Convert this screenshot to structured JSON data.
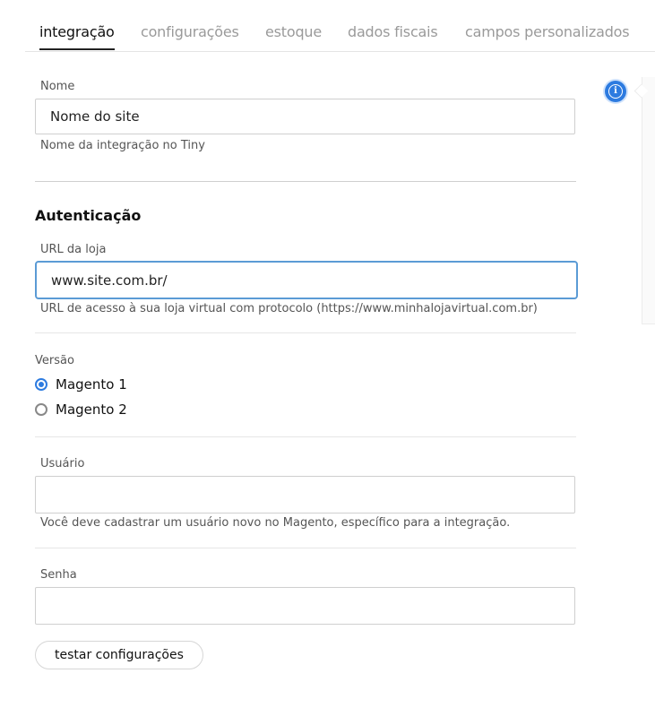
{
  "tabs": [
    {
      "label": "integração",
      "active": true
    },
    {
      "label": "configurações",
      "active": false
    },
    {
      "label": "estoque",
      "active": false
    },
    {
      "label": "dados fiscais",
      "active": false
    },
    {
      "label": "campos personalizados",
      "active": false
    }
  ],
  "nome": {
    "label": "Nome",
    "value": "Nome do site",
    "hint": "Nome da integração no Tiny"
  },
  "autenticacao": {
    "title": "Autenticação",
    "url": {
      "label": "URL da loja",
      "value": "www.site.com.br/",
      "hint": "URL de acesso à sua loja virtual com protocolo (https://www.minhalojavirtual.com.br)"
    },
    "versao": {
      "label": "Versão",
      "options": [
        "Magento 1",
        "Magento 2"
      ],
      "selected": "Magento 1"
    },
    "usuario": {
      "label": "Usuário",
      "value": "",
      "hint": "Você deve cadastrar um usuário novo no Magento, específico para a integração."
    },
    "senha": {
      "label": "Senha",
      "value": ""
    }
  },
  "test_button": "testar configurações",
  "icons": {
    "info": "info-icon"
  },
  "colors": {
    "accent": "#2d7be0",
    "focus_border": "#5b9bd5"
  }
}
